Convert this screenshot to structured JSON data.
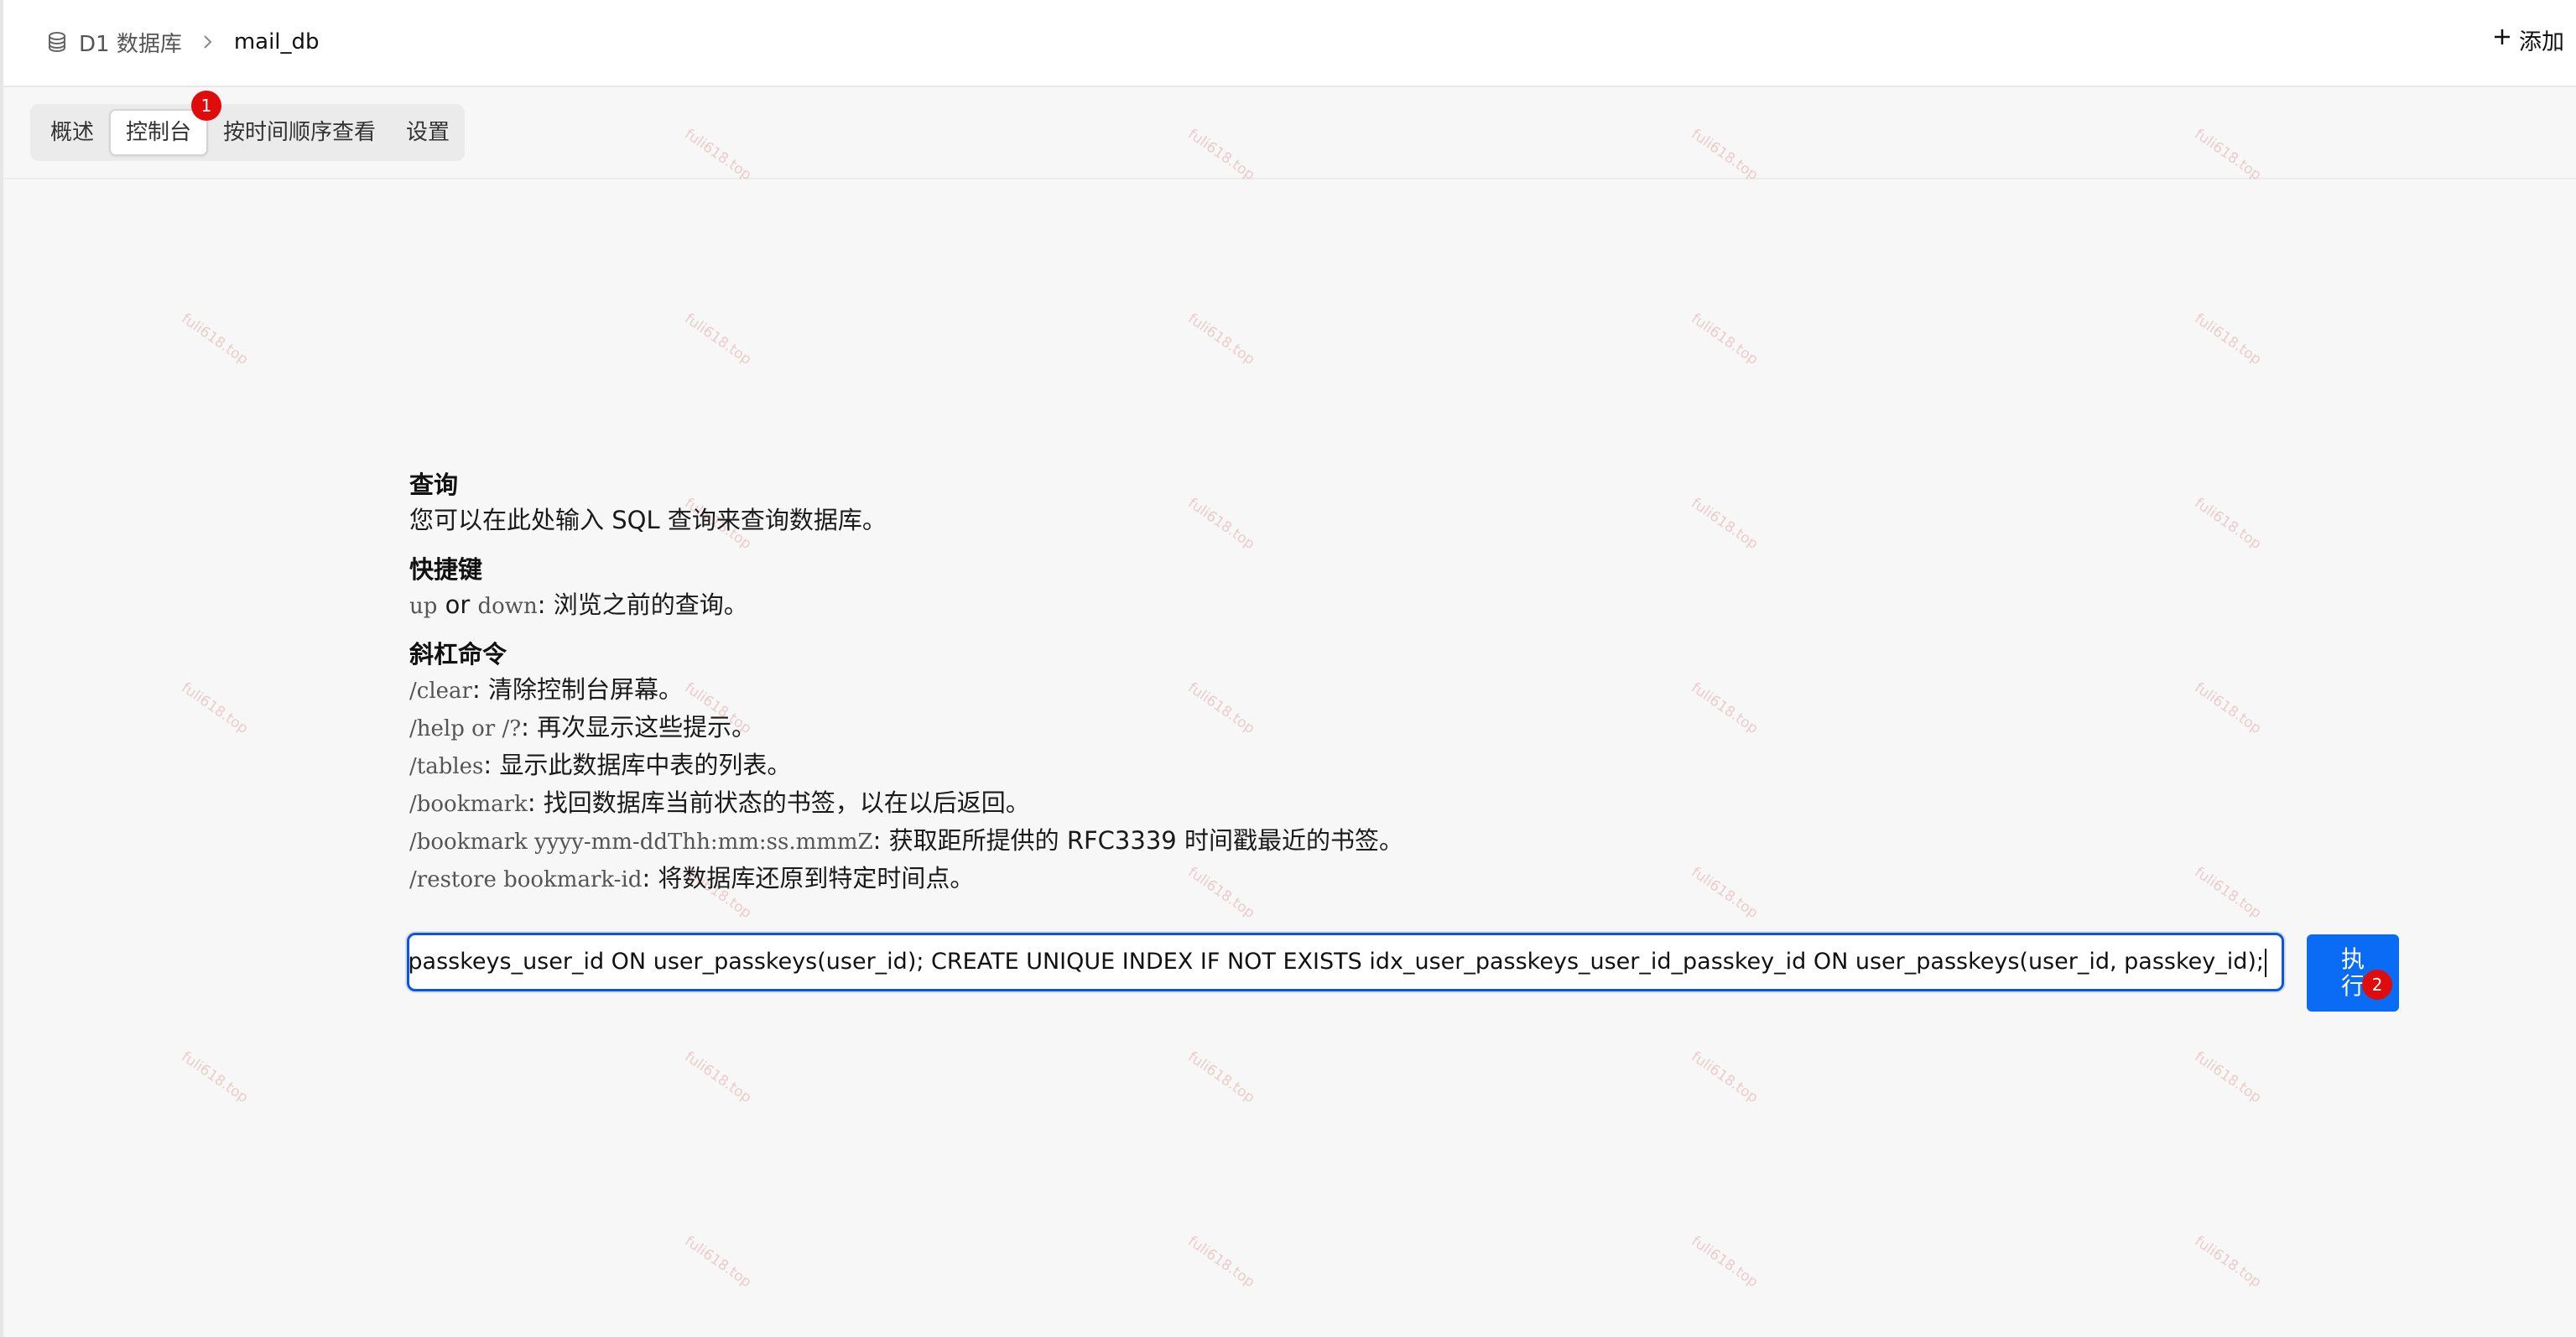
{
  "header": {
    "breadcrumb": {
      "root_icon": "database-icon",
      "root_label": "D1 数据库",
      "separator_icon": "chevron-right-icon",
      "current_label": "mail_db"
    },
    "add_icon": "plus-icon",
    "add_label": "添加"
  },
  "tabs": [
    {
      "label": "概述",
      "active": false
    },
    {
      "label": "控制台",
      "active": true,
      "badge": "1"
    },
    {
      "label": "按时间顺序查看",
      "active": false
    },
    {
      "label": "设置",
      "active": false
    }
  ],
  "watermark_text": "fuli618.top",
  "help": {
    "query_title": "查询",
    "query_desc": "您可以在此处输入 SQL 查询来查询数据库。",
    "shortcuts_title": "快捷键",
    "shortcut_up": "up",
    "shortcut_or": " or ",
    "shortcut_down": "down",
    "shortcut_desc": ": 浏览之前的查询。",
    "slash_title": "斜杠命令",
    "commands": [
      {
        "cmd": "/clear",
        "desc": ": 清除控制台屏幕。"
      },
      {
        "cmd": "/help or /?",
        "desc": ": 再次显示这些提示。"
      },
      {
        "cmd": "/tables",
        "desc": ": 显示此数据库中表的列表。"
      },
      {
        "cmd": "/bookmark",
        "desc": ": 找回数据库当前状态的书签，以在以后返回。"
      },
      {
        "cmd": "/bookmark yyyy-mm-ddThh:mm:ss.mmmZ",
        "desc": ": 获取距所提供的 RFC3339 时间戳最近的书签。"
      },
      {
        "cmd": "/restore bookmark-id",
        "desc": ": 将数据库还原到特定时间点。"
      }
    ]
  },
  "query_input": {
    "value": "ISTS idx_user_passkeys_user_id ON user_passkeys(user_id);  CREATE UNIQUE INDEX IF NOT EXISTS idx_user_passkeys_user_id_passkey_id ON user_passkeys(user_id, passkey_id);"
  },
  "run_button": {
    "label": "执行",
    "badge": "2"
  },
  "colors": {
    "accent": "#0a6cf5",
    "focus_border": "#0d55e0",
    "badge": "#e00b0b",
    "watermark": "#d77878"
  }
}
